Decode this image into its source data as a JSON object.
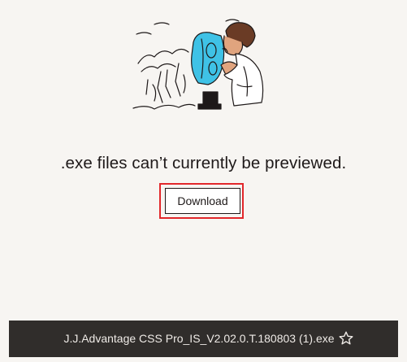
{
  "preview": {
    "message": ".exe files can’t currently be previewed.",
    "download_label": "Download",
    "highlight_color": "#e2272b"
  },
  "footer": {
    "filename": "J.J.Advantage CSS Pro_IS_V2.02.0.T.180803 (1).exe",
    "star_icon": "star-outline-icon"
  },
  "illustration": {
    "subject": "person-looking-through-viewer-binoculars",
    "accent_color": "#3fc2e6"
  }
}
